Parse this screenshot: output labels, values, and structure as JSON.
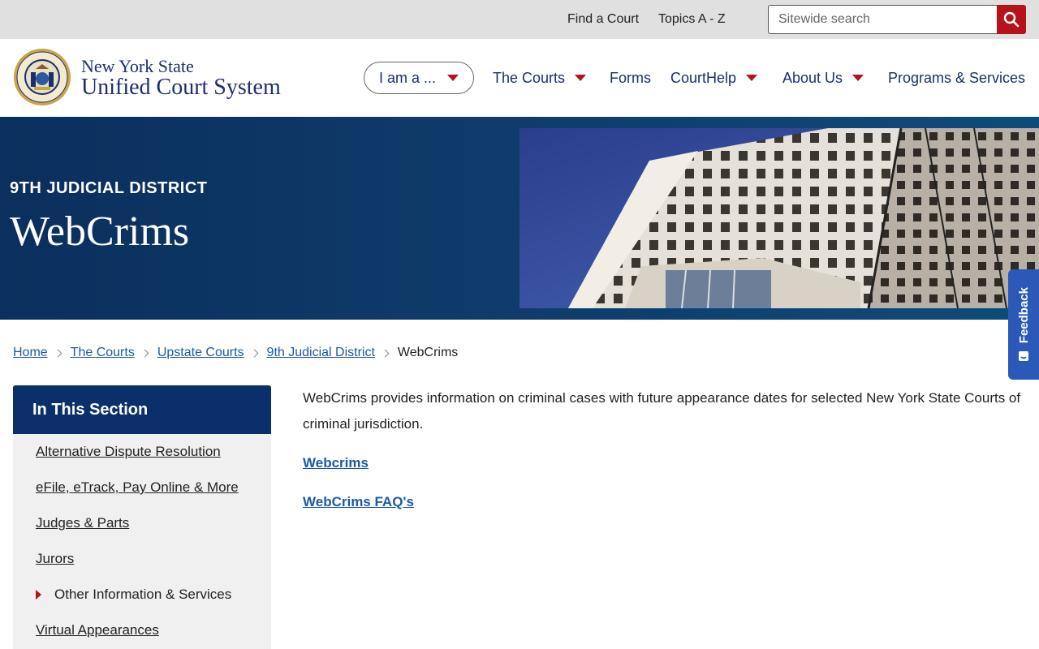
{
  "utility": {
    "find_court": "Find a Court",
    "topics": "Topics A - Z",
    "search_placeholder": "Sitewide search"
  },
  "logo": {
    "line1": "New York State",
    "line2": "Unified Court System"
  },
  "nav": {
    "iam": "I am a ...",
    "courts": "The Courts",
    "forms": "Forms",
    "courthelp": "CourtHelp",
    "about": "About Us",
    "programs": "Programs & Services"
  },
  "hero": {
    "kicker": "9TH JUDICIAL DISTRICT",
    "title": "WebCrims"
  },
  "feedback": "Feedback",
  "breadcrumb": [
    "Home",
    "The Courts",
    "Upstate Courts",
    "9th Judicial District",
    "WebCrims"
  ],
  "sidebar": {
    "heading": "In This Section",
    "items": [
      "Alternative Dispute Resolution",
      "eFile, eTrack, Pay Online & More",
      "Judges & Parts",
      "Jurors",
      "Other Information & Services",
      "Virtual Appearances"
    ]
  },
  "content": {
    "paragraph": "WebCrims provides information on criminal cases with future appearance dates for selected New York State Courts of criminal jurisdiction.",
    "links": [
      "Webcrims",
      "WebCrims FAQ's"
    ]
  },
  "colors": {
    "navy": "#0b2f6a",
    "brand_red": "#b5121b",
    "link_blue": "#1a5aa6",
    "feedback_blue": "#2b59b8"
  }
}
